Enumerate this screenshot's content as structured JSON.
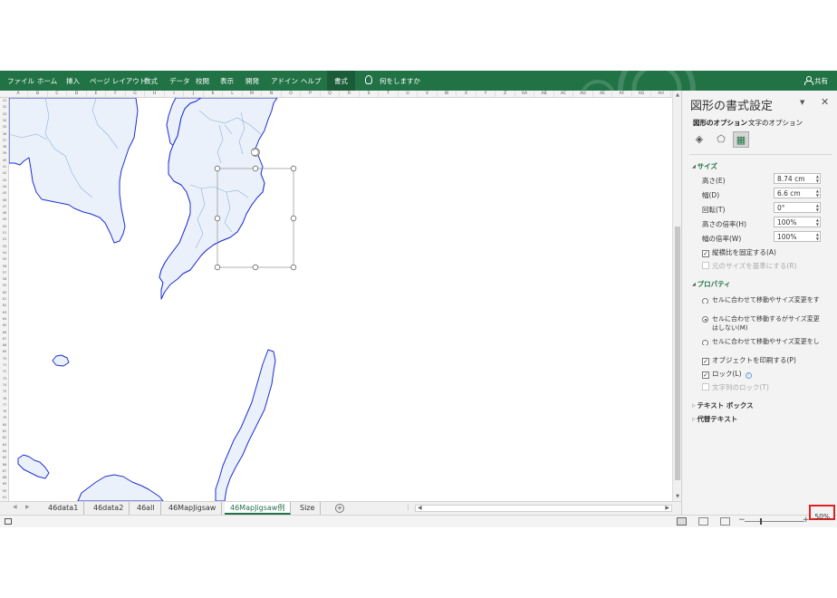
{
  "ribbon": {
    "tabs": [
      "ファイル",
      "ホーム",
      "挿入",
      "ページ レイアウト",
      "数式",
      "データ",
      "校閲",
      "表示",
      "開発",
      "アドイン",
      "ヘルプ"
    ],
    "active_tab": "書式",
    "tell_me": "何をしますか",
    "share": "共有"
  },
  "columns": [
    "A",
    "B",
    "C",
    "D",
    "E",
    "F",
    "G",
    "H",
    "I",
    "J",
    "K",
    "L",
    "M",
    "N",
    "O",
    "P",
    "Q",
    "R",
    "S",
    "T",
    "U",
    "V",
    "W",
    "X",
    "Y",
    "Z",
    "AA",
    "AB",
    "AC",
    "AD",
    "AE",
    "AF",
    "AG",
    "AH"
  ],
  "rows": {
    "first": 31,
    "count": 61
  },
  "sheet_tabs": [
    "46data1",
    "46data2",
    "46all",
    "46MapJigsaw",
    "46MapJigsaw例",
    "Size"
  ],
  "active_sheet": "46MapJigsaw例",
  "status": {
    "zoom": "50%"
  },
  "pane": {
    "title": "図形の書式設定",
    "option_shape": "図形のオプション",
    "option_text": "文字のオプション",
    "size": {
      "heading": "サイズ",
      "height_label": "高さ(E)",
      "height_value": "8.74 cm",
      "width_label": "幅(D)",
      "width_value": "6.6 cm",
      "rotation_label": "回転(T)",
      "rotation_value": "0°",
      "scale_h_label": "高さの倍率(H)",
      "scale_h_value": "100%",
      "scale_w_label": "幅の倍率(W)",
      "scale_w_value": "100%",
      "lock_aspect": "縦横比を固定する(A)",
      "relative_original": "元のサイズを基準にする(R)"
    },
    "properties": {
      "heading": "プロパティ",
      "opt1": "セルに合わせて移動やサイズ変更をする(S)",
      "opt2": "セルに合わせて移動するがサイズ変更はしない(M)",
      "opt3": "セルに合わせて移動やサイズ変更をしない(D)",
      "print": "オブジェクトを印刷する(P)",
      "locked": "ロック(L)",
      "lock_text": "文字列のロック(T)"
    },
    "textbox": "テキスト ボックス",
    "alt_text": "代替テキスト"
  }
}
